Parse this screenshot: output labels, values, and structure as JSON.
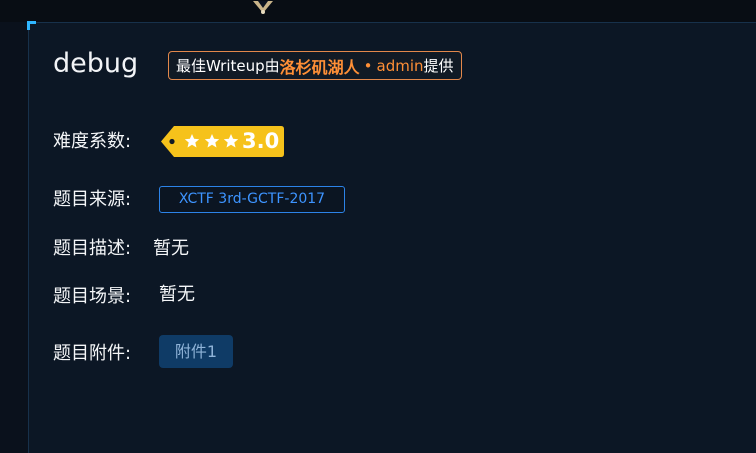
{
  "challenge": {
    "title": "debug"
  },
  "writeup_badge": {
    "prefix": "最佳Writeup由",
    "author": "洛杉矶湖人",
    "separator": "•",
    "role": "admin",
    "suffix": "提供"
  },
  "fields": {
    "difficulty_label": "难度系数:",
    "difficulty_value": "3.0",
    "difficulty_stars": 3,
    "source_label": "题目来源:",
    "source_value": "XCTF 3rd-GCTF-2017",
    "description_label": "题目描述:",
    "description_value": "暂无",
    "scene_label": "题目场景:",
    "scene_value": "暂无",
    "attachment_label": "题目附件:",
    "attachment_button": "附件1"
  },
  "colors": {
    "background": "#0b1320",
    "card": "#0c1725",
    "badge_border": "#e3884b",
    "badge_highlight": "#ff8f36",
    "difficulty_tag": "#f6c21b",
    "source_tag_border": "#2c83e8",
    "source_tag_text": "#3d94ff",
    "attachment_button_bg": "#0f3b66",
    "attachment_button_text": "#8fb3d8",
    "corner_accent": "#2fb6ff"
  },
  "icons": {
    "difficulty": "star-icon",
    "top_ornament": "ornament-icon"
  }
}
